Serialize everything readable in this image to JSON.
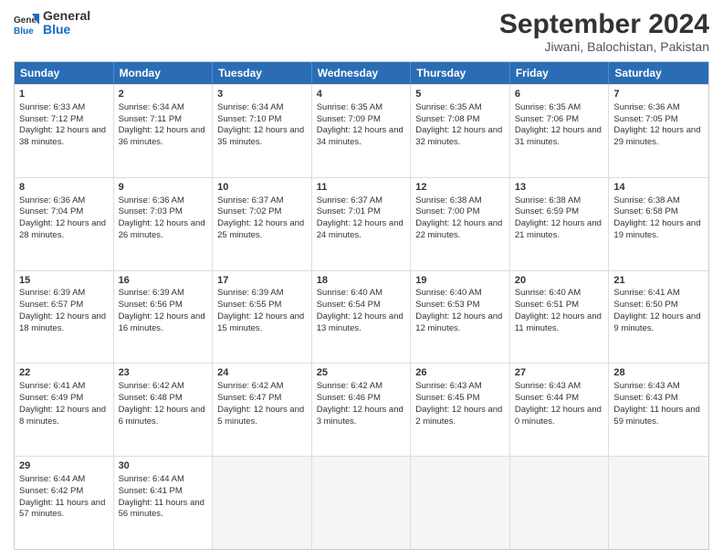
{
  "logo": {
    "general": "General",
    "blue": "Blue"
  },
  "title": "September 2024",
  "subtitle": "Jiwani, Balochistan, Pakistan",
  "days": [
    "Sunday",
    "Monday",
    "Tuesday",
    "Wednesday",
    "Thursday",
    "Friday",
    "Saturday"
  ],
  "weeks": [
    [
      {
        "day": "1",
        "sunrise": "Sunrise: 6:33 AM",
        "sunset": "Sunset: 7:12 PM",
        "daylight": "Daylight: 12 hours and 38 minutes."
      },
      {
        "day": "2",
        "sunrise": "Sunrise: 6:34 AM",
        "sunset": "Sunset: 7:11 PM",
        "daylight": "Daylight: 12 hours and 36 minutes."
      },
      {
        "day": "3",
        "sunrise": "Sunrise: 6:34 AM",
        "sunset": "Sunset: 7:10 PM",
        "daylight": "Daylight: 12 hours and 35 minutes."
      },
      {
        "day": "4",
        "sunrise": "Sunrise: 6:35 AM",
        "sunset": "Sunset: 7:09 PM",
        "daylight": "Daylight: 12 hours and 34 minutes."
      },
      {
        "day": "5",
        "sunrise": "Sunrise: 6:35 AM",
        "sunset": "Sunset: 7:08 PM",
        "daylight": "Daylight: 12 hours and 32 minutes."
      },
      {
        "day": "6",
        "sunrise": "Sunrise: 6:35 AM",
        "sunset": "Sunset: 7:06 PM",
        "daylight": "Daylight: 12 hours and 31 minutes."
      },
      {
        "day": "7",
        "sunrise": "Sunrise: 6:36 AM",
        "sunset": "Sunset: 7:05 PM",
        "daylight": "Daylight: 12 hours and 29 minutes."
      }
    ],
    [
      {
        "day": "8",
        "sunrise": "Sunrise: 6:36 AM",
        "sunset": "Sunset: 7:04 PM",
        "daylight": "Daylight: 12 hours and 28 minutes."
      },
      {
        "day": "9",
        "sunrise": "Sunrise: 6:36 AM",
        "sunset": "Sunset: 7:03 PM",
        "daylight": "Daylight: 12 hours and 26 minutes."
      },
      {
        "day": "10",
        "sunrise": "Sunrise: 6:37 AM",
        "sunset": "Sunset: 7:02 PM",
        "daylight": "Daylight: 12 hours and 25 minutes."
      },
      {
        "day": "11",
        "sunrise": "Sunrise: 6:37 AM",
        "sunset": "Sunset: 7:01 PM",
        "daylight": "Daylight: 12 hours and 24 minutes."
      },
      {
        "day": "12",
        "sunrise": "Sunrise: 6:38 AM",
        "sunset": "Sunset: 7:00 PM",
        "daylight": "Daylight: 12 hours and 22 minutes."
      },
      {
        "day": "13",
        "sunrise": "Sunrise: 6:38 AM",
        "sunset": "Sunset: 6:59 PM",
        "daylight": "Daylight: 12 hours and 21 minutes."
      },
      {
        "day": "14",
        "sunrise": "Sunrise: 6:38 AM",
        "sunset": "Sunset: 6:58 PM",
        "daylight": "Daylight: 12 hours and 19 minutes."
      }
    ],
    [
      {
        "day": "15",
        "sunrise": "Sunrise: 6:39 AM",
        "sunset": "Sunset: 6:57 PM",
        "daylight": "Daylight: 12 hours and 18 minutes."
      },
      {
        "day": "16",
        "sunrise": "Sunrise: 6:39 AM",
        "sunset": "Sunset: 6:56 PM",
        "daylight": "Daylight: 12 hours and 16 minutes."
      },
      {
        "day": "17",
        "sunrise": "Sunrise: 6:39 AM",
        "sunset": "Sunset: 6:55 PM",
        "daylight": "Daylight: 12 hours and 15 minutes."
      },
      {
        "day": "18",
        "sunrise": "Sunrise: 6:40 AM",
        "sunset": "Sunset: 6:54 PM",
        "daylight": "Daylight: 12 hours and 13 minutes."
      },
      {
        "day": "19",
        "sunrise": "Sunrise: 6:40 AM",
        "sunset": "Sunset: 6:53 PM",
        "daylight": "Daylight: 12 hours and 12 minutes."
      },
      {
        "day": "20",
        "sunrise": "Sunrise: 6:40 AM",
        "sunset": "Sunset: 6:51 PM",
        "daylight": "Daylight: 12 hours and 11 minutes."
      },
      {
        "day": "21",
        "sunrise": "Sunrise: 6:41 AM",
        "sunset": "Sunset: 6:50 PM",
        "daylight": "Daylight: 12 hours and 9 minutes."
      }
    ],
    [
      {
        "day": "22",
        "sunrise": "Sunrise: 6:41 AM",
        "sunset": "Sunset: 6:49 PM",
        "daylight": "Daylight: 12 hours and 8 minutes."
      },
      {
        "day": "23",
        "sunrise": "Sunrise: 6:42 AM",
        "sunset": "Sunset: 6:48 PM",
        "daylight": "Daylight: 12 hours and 6 minutes."
      },
      {
        "day": "24",
        "sunrise": "Sunrise: 6:42 AM",
        "sunset": "Sunset: 6:47 PM",
        "daylight": "Daylight: 12 hours and 5 minutes."
      },
      {
        "day": "25",
        "sunrise": "Sunrise: 6:42 AM",
        "sunset": "Sunset: 6:46 PM",
        "daylight": "Daylight: 12 hours and 3 minutes."
      },
      {
        "day": "26",
        "sunrise": "Sunrise: 6:43 AM",
        "sunset": "Sunset: 6:45 PM",
        "daylight": "Daylight: 12 hours and 2 minutes."
      },
      {
        "day": "27",
        "sunrise": "Sunrise: 6:43 AM",
        "sunset": "Sunset: 6:44 PM",
        "daylight": "Daylight: 12 hours and 0 minutes."
      },
      {
        "day": "28",
        "sunrise": "Sunrise: 6:43 AM",
        "sunset": "Sunset: 6:43 PM",
        "daylight": "Daylight: 11 hours and 59 minutes."
      }
    ],
    [
      {
        "day": "29",
        "sunrise": "Sunrise: 6:44 AM",
        "sunset": "Sunset: 6:42 PM",
        "daylight": "Daylight: 11 hours and 57 minutes."
      },
      {
        "day": "30",
        "sunrise": "Sunrise: 6:44 AM",
        "sunset": "Sunset: 6:41 PM",
        "daylight": "Daylight: 11 hours and 56 minutes."
      },
      null,
      null,
      null,
      null,
      null
    ]
  ]
}
